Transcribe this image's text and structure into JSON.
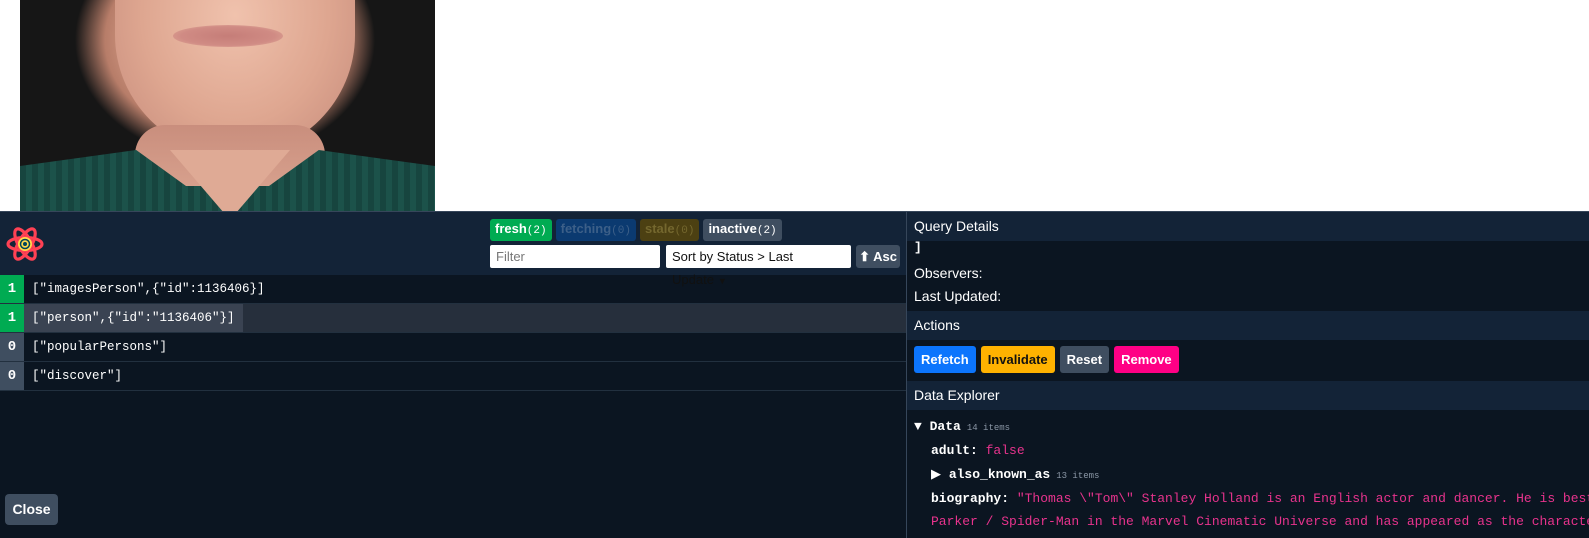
{
  "page": {
    "photo_alt": "portrait-photo"
  },
  "devtools": {
    "status_chips": [
      {
        "label": "fresh",
        "count": "(2)",
        "color": "#00ab52"
      },
      {
        "label": "fetching",
        "count": "(0)",
        "color": "#0b3a70"
      },
      {
        "label": "stale",
        "count": "(0)",
        "color": "#4c4012"
      },
      {
        "label": "inactive",
        "count": "(2)",
        "color": "#3f4e60"
      }
    ],
    "filter_placeholder": "Filter",
    "sort_label": "Sort by Status > Last Update",
    "asc_label": "⬆ Asc",
    "queries": [
      {
        "count": "1",
        "key": "[\"imagesPerson\",{\"id\":1136406}]",
        "status": "fresh"
      },
      {
        "count": "1",
        "key": "[\"person\",{\"id\":\"1136406\"}]",
        "status": "fresh",
        "selected": true
      },
      {
        "count": "0",
        "key": "[\"popularPersons\"]",
        "status": "inactive"
      },
      {
        "count": "0",
        "key": "[\"discover\"]",
        "status": "inactive"
      }
    ],
    "close_label": "Close"
  },
  "details": {
    "query_details_title": "Query Details",
    "query_hash_tail": "]",
    "observers_label": "Observers:",
    "last_updated_label": "Last Updated:",
    "actions_title": "Actions",
    "actions": {
      "refetch": "Refetch",
      "invalidate": "Invalidate",
      "reset": "Reset",
      "remove": "Remove"
    },
    "data_explorer_title": "Data Explorer",
    "data_root": {
      "arrow": "▼",
      "label": "Data",
      "items": "14 items"
    },
    "adult": {
      "key": "adult:",
      "value": "false"
    },
    "also_known_as": {
      "arrow": "▶",
      "key": "also_known_as",
      "items": "13 items"
    },
    "biography": {
      "key": "biography:",
      "line1": "\"Thomas \\\"Tom\\\" Stanley Holland is an English actor and dancer. He is best",
      "line2": "Parker / Spider-Man in the Marvel Cinematic Universe and has appeared as the character"
    }
  }
}
